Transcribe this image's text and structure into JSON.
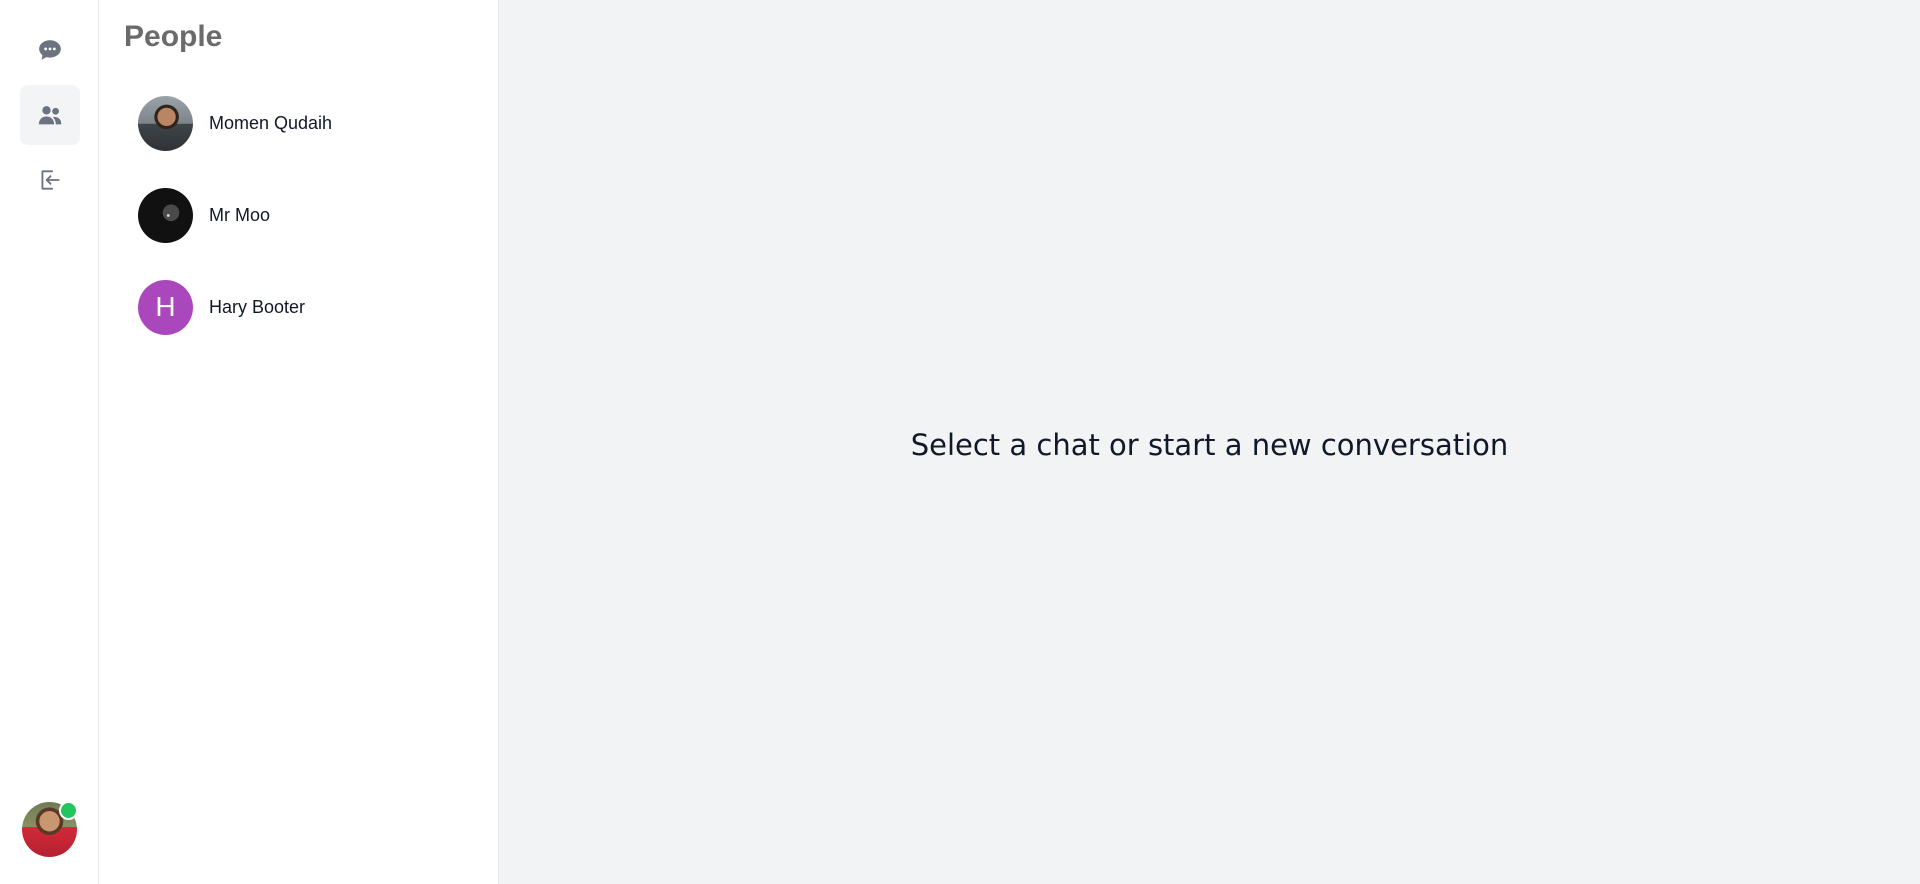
{
  "nav": {
    "items": [
      {
        "icon": "chat-bubble-icon",
        "label": "Chats",
        "active": false
      },
      {
        "icon": "people-icon",
        "label": "People",
        "active": true
      },
      {
        "icon": "logout-icon",
        "label": "Logout",
        "active": false
      }
    ],
    "current_user": {
      "status": "online",
      "status_color": "#22c55e"
    }
  },
  "people_panel": {
    "title": "People",
    "people": [
      {
        "name": "Momen Qudaih",
        "avatar": "photo"
      },
      {
        "name": "Mr Moo",
        "avatar": "photo"
      },
      {
        "name": "Hary Booter",
        "avatar": "initial",
        "initial": "H",
        "color": "#ab47bc"
      }
    ]
  },
  "main": {
    "empty_message": "Select a chat or start a new conversation"
  },
  "colors": {
    "main_background": "#f2f3f5",
    "active_nav_background": "#f3f4f6",
    "title_color": "#6b6b6b"
  }
}
